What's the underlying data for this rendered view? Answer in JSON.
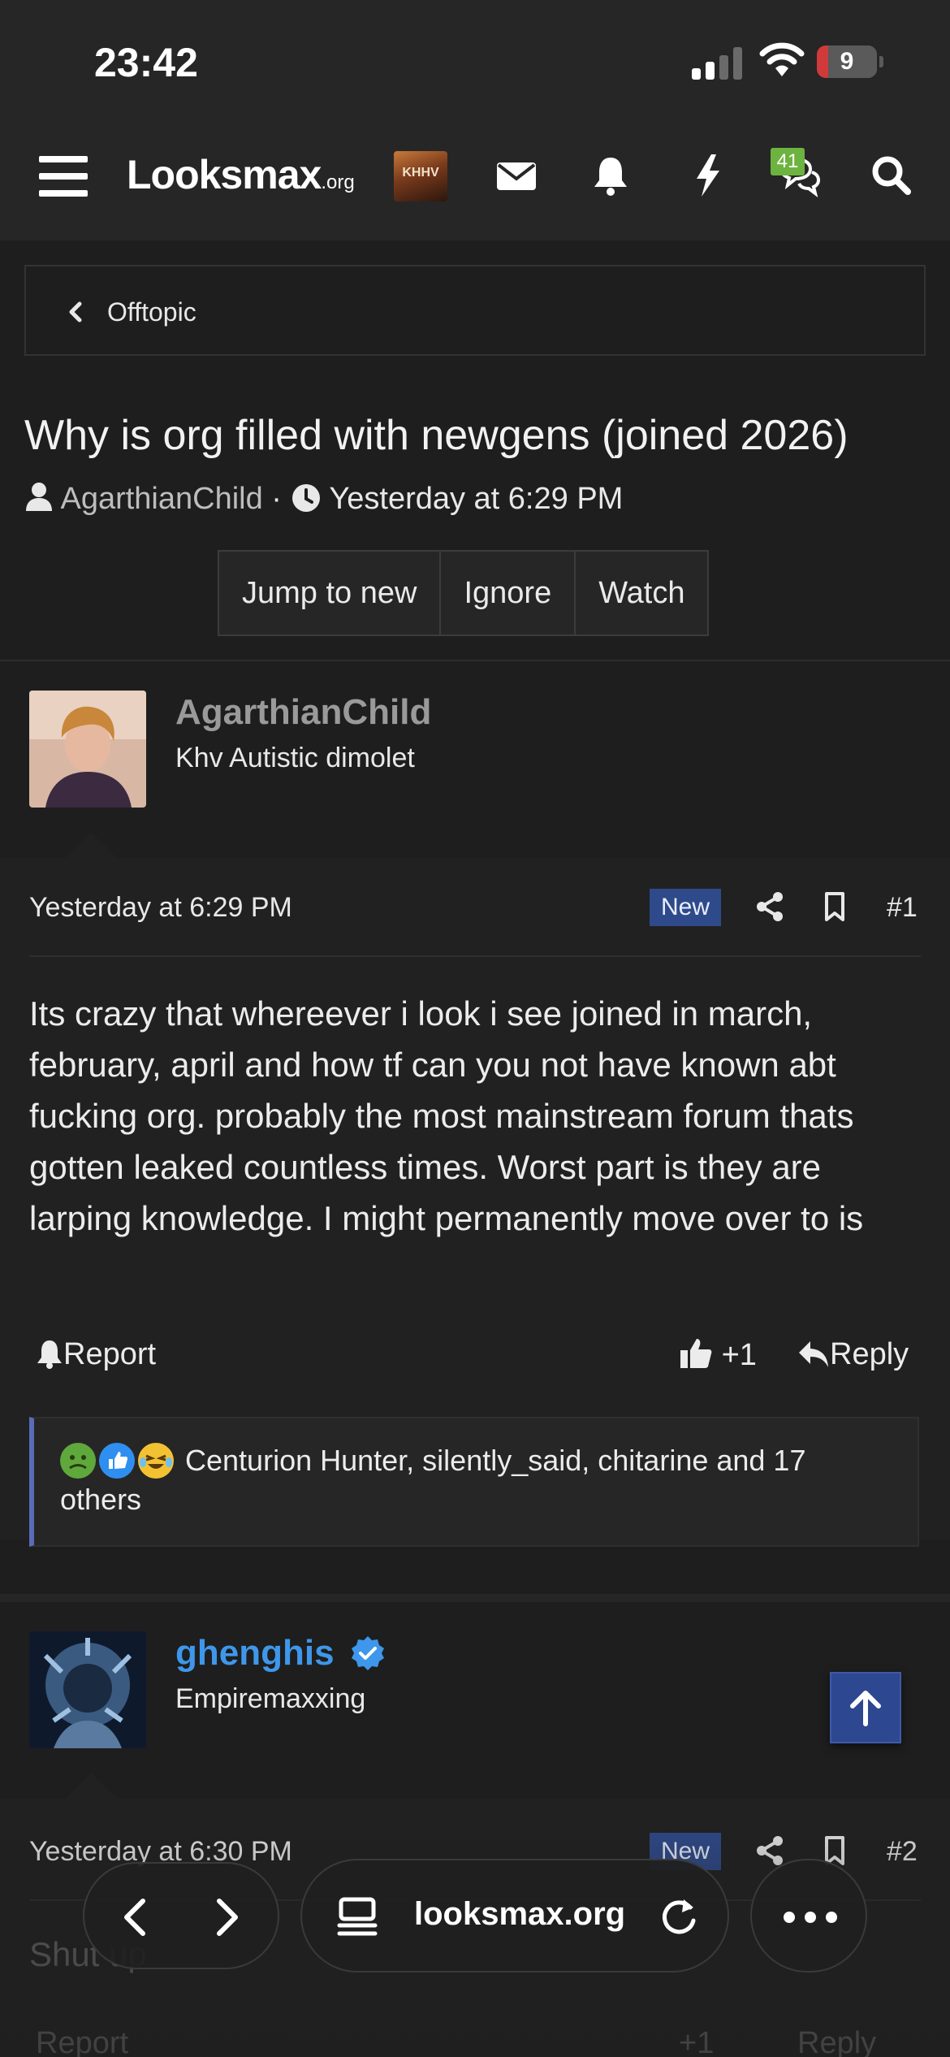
{
  "status_bar": {
    "time": "23:42",
    "battery": "9"
  },
  "header": {
    "logo_main": "Looksmax",
    "logo_suffix": ".org",
    "avatar_text": "KHHV",
    "icons": [
      "menu-icon",
      "envelope-icon",
      "bell-icon",
      "bolt-icon",
      "chat-icon",
      "search-icon"
    ],
    "chat_badge": "41"
  },
  "breadcrumb": {
    "label": "Offtopic"
  },
  "thread": {
    "title": "Why is org filled with newgens (joined 2026)",
    "author": "AgarthianChild",
    "separator": "·",
    "date": "Yesterday at 6:29 PM",
    "buttons": {
      "jump": "Jump to new",
      "ignore": "Ignore",
      "watch": "Watch"
    }
  },
  "posts": [
    {
      "username": "AgarthianChild",
      "user_title": "Khv Autistic dimolet",
      "date": "Yesterday at 6:29 PM",
      "badge": "New",
      "number": "#1",
      "message": "Its crazy that whereever i look i see joined in march, february, april and how tf can you not have known abt fucking org. probably the most mainstream forum thats gotten leaked countless times. Worst part is they are larping knowledge. I might permanently move over to is",
      "report": "Report",
      "like_count": "+1",
      "reply": "Reply",
      "reactions_text": "Centurion Hunter, silently_said, chitarine and 17 others"
    },
    {
      "username": "ghenghis",
      "user_title": "Empiremaxxing",
      "date": "Yesterday at 6:30 PM",
      "badge": "New",
      "number": "#2",
      "message_partial": "Shut up",
      "report": "Report",
      "like_count": "+1",
      "reply": "Reply"
    }
  ],
  "browser": {
    "url": "looksmax.org"
  },
  "colors": {
    "accent_blue": "#2f4a8a",
    "username_blue": "#3e97ea",
    "badge_green": "#6db33f"
  }
}
